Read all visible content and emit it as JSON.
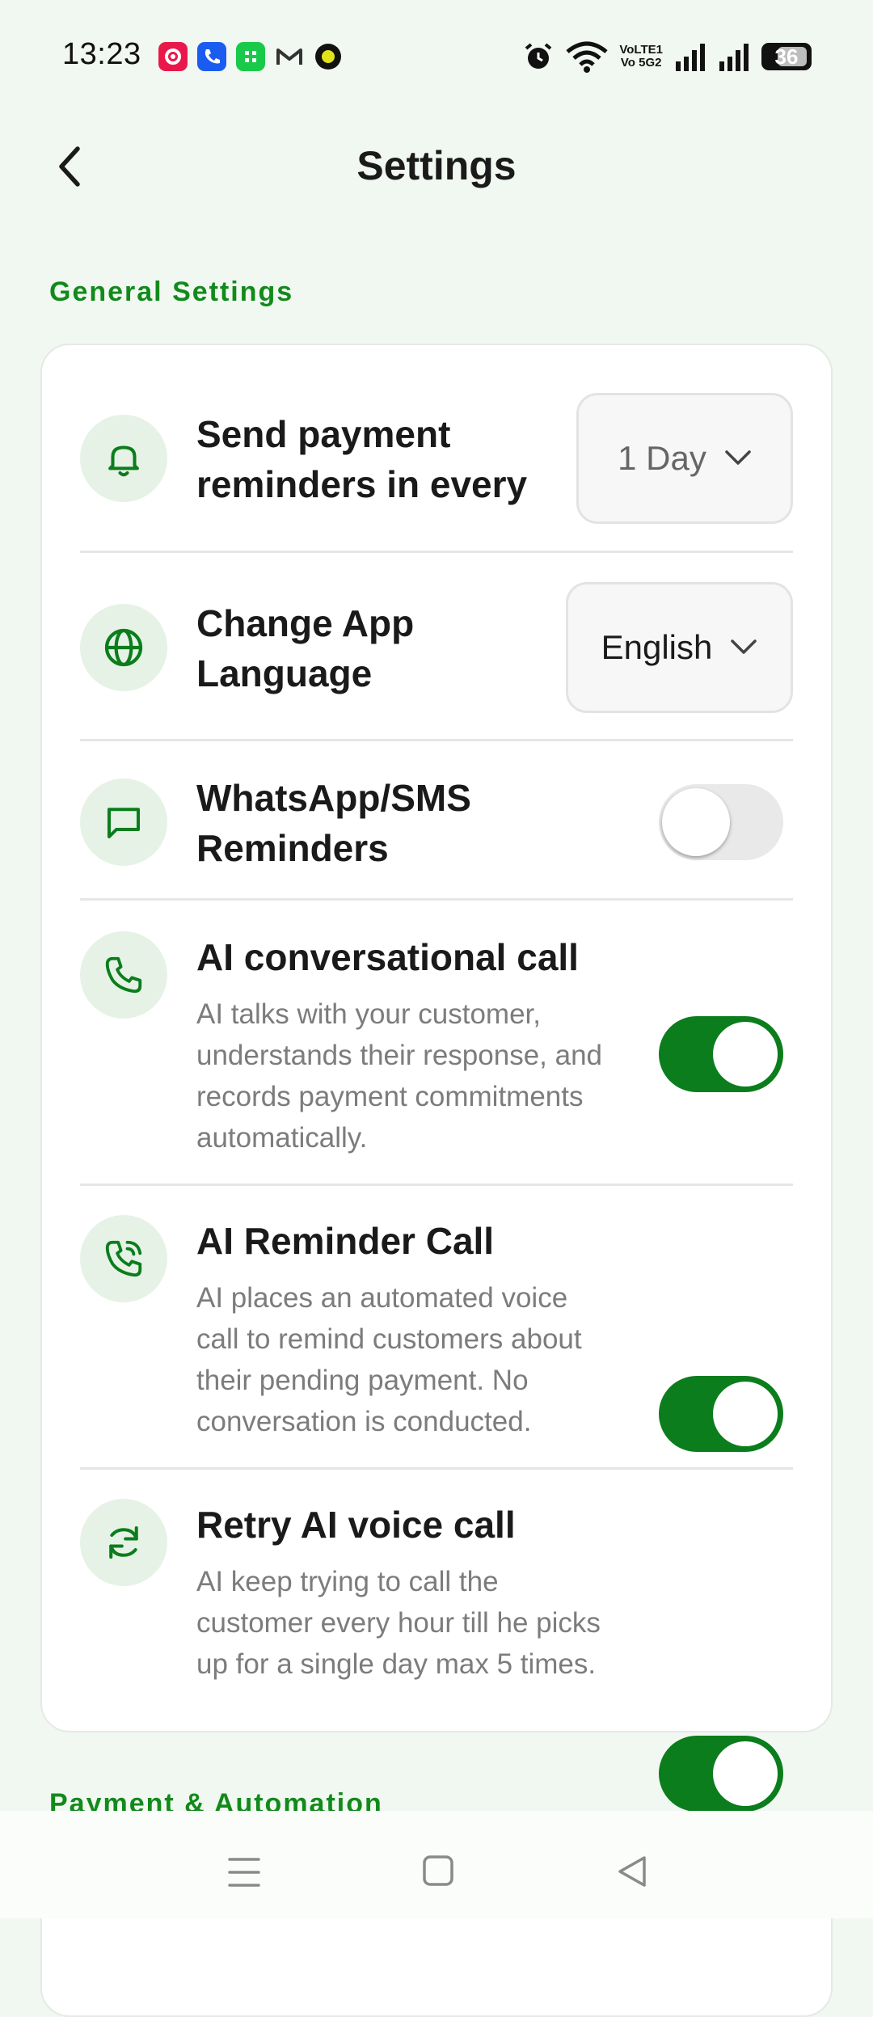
{
  "status_bar": {
    "time": "13:23",
    "battery": "36",
    "network_label_1": "VoLTE1",
    "network_label_2": "Vo 5G2",
    "notification_icons": [
      "settings-app-icon",
      "phone-app-icon",
      "messaging-app-icon",
      "gmail-icon",
      "music-app-icon"
    ]
  },
  "header": {
    "title": "Settings"
  },
  "sections": {
    "general": "General Settings",
    "payment": "Payment & Automation"
  },
  "rows": {
    "payment_reminder": {
      "title_line1": "Send payment",
      "title_line2": "reminders in every",
      "value": "1 Day"
    },
    "language": {
      "title_line1": "Change App",
      "title_line2": "Language",
      "value": "English"
    },
    "whatsapp_sms": {
      "title_line1": "WhatsApp/SMS",
      "title_line2": "Reminders",
      "enabled": false
    },
    "ai_conversational": {
      "title": "AI conversational call",
      "desc_lines": [
        "AI talks with your customer,",
        "understands their response, and",
        "records payment commitments",
        "automatically."
      ],
      "enabled": true
    },
    "ai_reminder": {
      "title": "AI Reminder Call",
      "desc_lines": [
        "AI places an automated voice",
        "call to remind customers about",
        "their pending payment. No",
        "conversation is conducted."
      ],
      "enabled": true
    },
    "retry_ai": {
      "title": "Retry AI voice call",
      "desc_lines": [
        "AI keep trying to call the",
        "customer every hour till he picks",
        "up for a single day max 5 times."
      ],
      "enabled": true
    }
  },
  "colors": {
    "accent": "#0b7d1c",
    "section_title": "#128a1b",
    "icon_bg": "#e6f2e6",
    "background": "#f1f7f1"
  }
}
